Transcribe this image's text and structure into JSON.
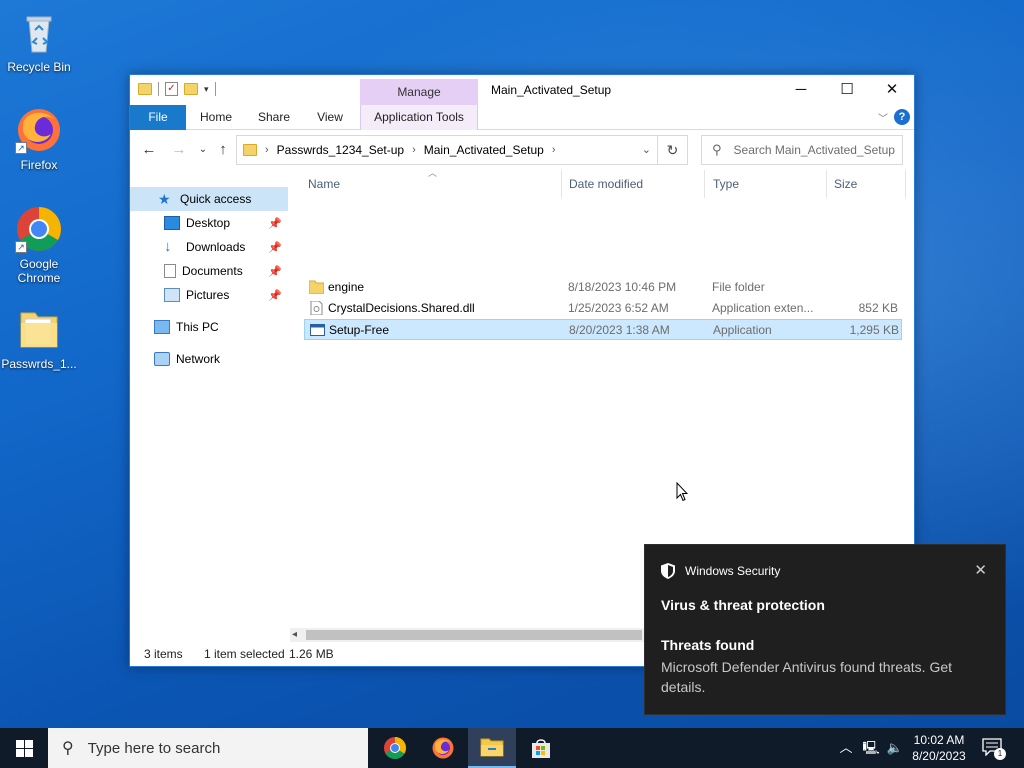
{
  "desktop": {
    "icons": [
      {
        "label": "Recycle Bin",
        "icon": "recycle-bin-icon"
      },
      {
        "label": "Firefox",
        "icon": "firefox-icon"
      },
      {
        "label": "Google Chrome",
        "icon": "chrome-icon"
      },
      {
        "label": "Passwrds_1...",
        "icon": "folder-icon"
      }
    ]
  },
  "window": {
    "title": "Main_Activated_Setup",
    "context_tab_group": "Manage",
    "controls": {
      "minimize": "─",
      "maximize": "☐",
      "close": "✕"
    },
    "ribbon_tabs": [
      "File",
      "Home",
      "Share",
      "View",
      "Application Tools"
    ],
    "help": "?",
    "address": {
      "crumbs": [
        "Passwrds_1234_Set-up",
        "Main_Activated_Setup"
      ]
    },
    "search": {
      "placeholder": "Search Main_Activated_Setup"
    },
    "nav_pane": {
      "quick_access": "Quick access",
      "pinned": [
        "Desktop",
        "Downloads",
        "Documents",
        "Pictures"
      ],
      "this_pc": "This PC",
      "network": "Network"
    },
    "columns": [
      "Name",
      "Date modified",
      "Type",
      "Size"
    ],
    "files": [
      {
        "name": "engine",
        "date": "8/18/2023 10:46 PM",
        "type": "File folder",
        "size": "",
        "icon": "folder-icon",
        "selected": false
      },
      {
        "name": "CrystalDecisions.Shared.dll",
        "date": "1/25/2023 6:52 AM",
        "type": "Application exten...",
        "size": "852 KB",
        "icon": "dll-icon",
        "selected": false
      },
      {
        "name": "Setup-Free",
        "date": "8/20/2023 1:38 AM",
        "type": "Application",
        "size": "1,295 KB",
        "icon": "application-icon",
        "selected": true
      }
    ],
    "status": {
      "items": "3 items",
      "selection": "1 item selected",
      "size": "1.26 MB"
    }
  },
  "toast": {
    "app": "Windows Security",
    "title": "Virus & threat protection",
    "subtitle": "Threats found",
    "body": "Microsoft Defender Antivirus found threats. Get details."
  },
  "taskbar": {
    "search_placeholder": "Type here to search",
    "apps": [
      "chrome-icon",
      "firefox-icon",
      "file-explorer-icon",
      "store-icon"
    ],
    "active_app": "file-explorer-icon",
    "time": "10:02 AM",
    "date": "8/20/2023",
    "notification_count": "1"
  },
  "colors": {
    "accent": "#1979ca",
    "selection": "#cce8ff",
    "manage_tab": "#e6cff4",
    "taskbar": "#101b2a",
    "toast_bg": "#1f1f1f"
  }
}
